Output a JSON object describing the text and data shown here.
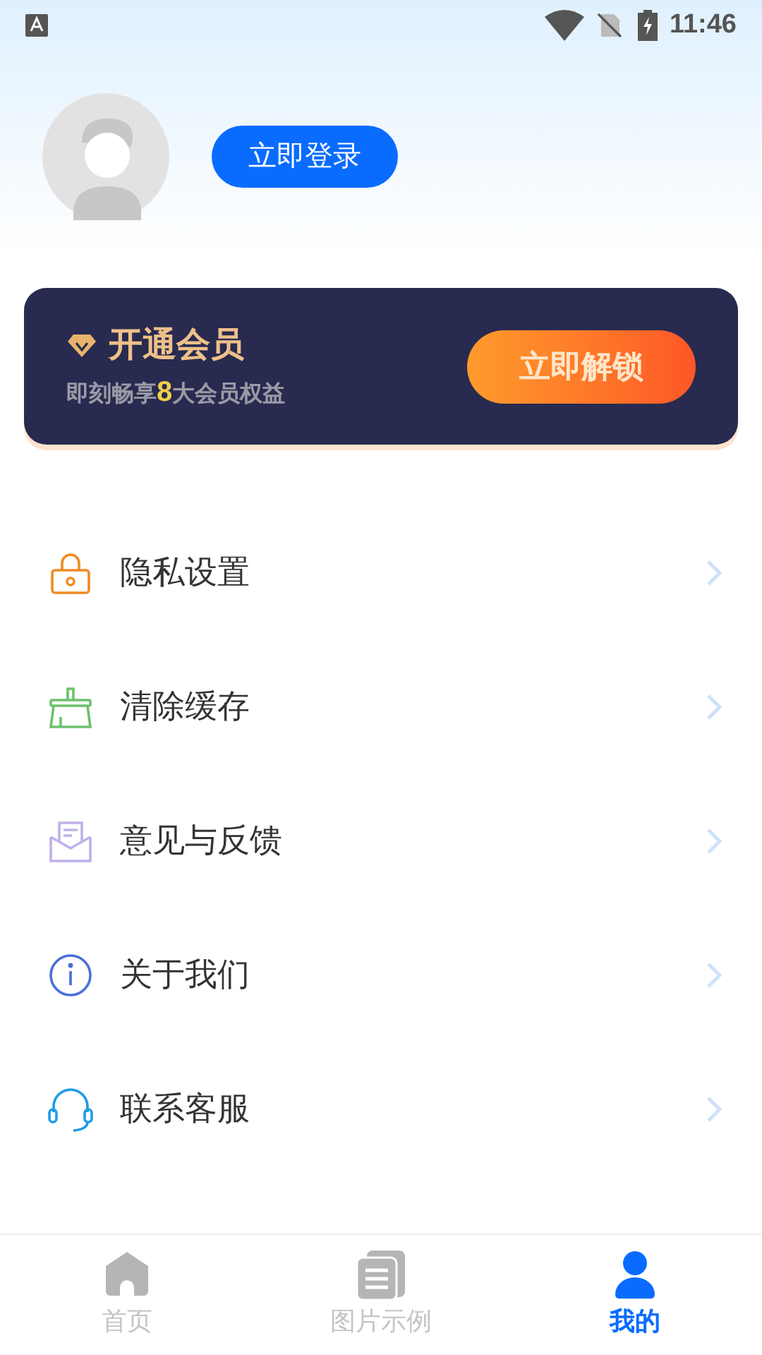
{
  "status_bar": {
    "time": "11:46"
  },
  "profile": {
    "login_button": "立即登录"
  },
  "vip_card": {
    "title": "开通会员",
    "subtitle": "即刻畅享**8**大会员权益",
    "button": "立即解锁"
  },
  "menu": [
    {
      "kind": "lock",
      "label": "隐私设置"
    },
    {
      "kind": "broom",
      "label": "清除缓存"
    },
    {
      "kind": "mail",
      "label": "意见与反馈"
    },
    {
      "kind": "info",
      "label": "关于我们"
    },
    {
      "kind": "headset",
      "label": "联系客服"
    }
  ],
  "bottom_nav": [
    {
      "kind": "home",
      "label": "首页",
      "selected": false
    },
    {
      "kind": "docs",
      "label": "图片示例",
      "selected": false
    },
    {
      "kind": "user",
      "label": "我的",
      "selected": true
    }
  ]
}
